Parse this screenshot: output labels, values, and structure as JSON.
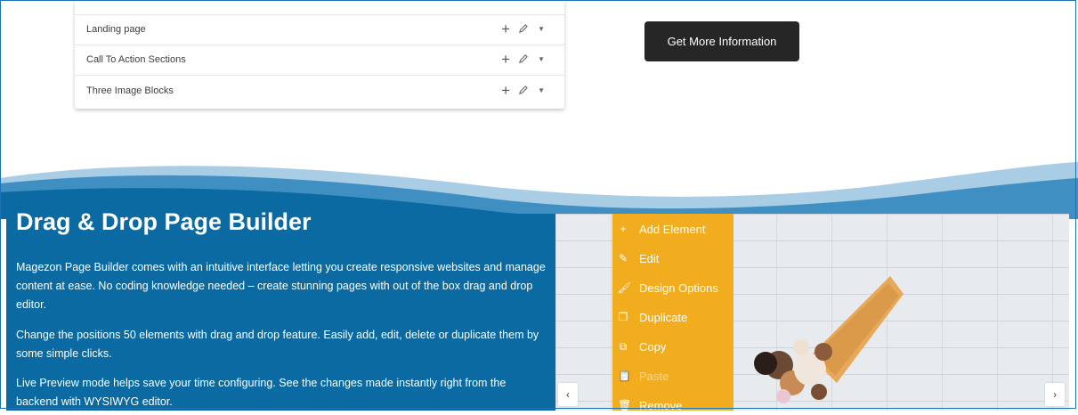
{
  "template_list": {
    "items": [
      {
        "label": "Landing page"
      },
      {
        "label": "Call To Action Sections"
      },
      {
        "label": "Three Image Blocks"
      }
    ]
  },
  "cta_button": {
    "label": "Get More Information"
  },
  "section": {
    "heading": "Drag & Drop Page Builder",
    "paragraphs": [
      "Magezon Page Builder comes with an intuitive interface letting you create responsive websites and manage content at ease. No coding knowledge needed – create stunning pages with out of the box drag and drop editor.",
      "Change the positions 50 elements with drag and drop feature. Easily add, edit, delete or duplicate them by some simple clicks.",
      "Live Preview mode helps save your time configuring. See the changes made instantly right from the backend with WYSIWYG editor."
    ]
  },
  "context_menu": {
    "items": [
      {
        "label": "Add Element",
        "icon": "plus-icon"
      },
      {
        "label": "Edit",
        "icon": "pencil-icon"
      },
      {
        "label": "Design Options",
        "icon": "brush-icon"
      },
      {
        "label": "Duplicate",
        "icon": "duplicate-icon"
      },
      {
        "label": "Copy",
        "icon": "copy-icon"
      },
      {
        "label": "Paste",
        "icon": "paste-icon"
      },
      {
        "label": "Remove",
        "icon": "trash-icon"
      }
    ]
  },
  "carousel": {
    "prev_icon": "chevron-left-icon",
    "next_icon": "chevron-right-icon"
  },
  "colors": {
    "menu": "#f2ad1e",
    "section_blue": "#0a6aa1",
    "button": "#262626"
  }
}
